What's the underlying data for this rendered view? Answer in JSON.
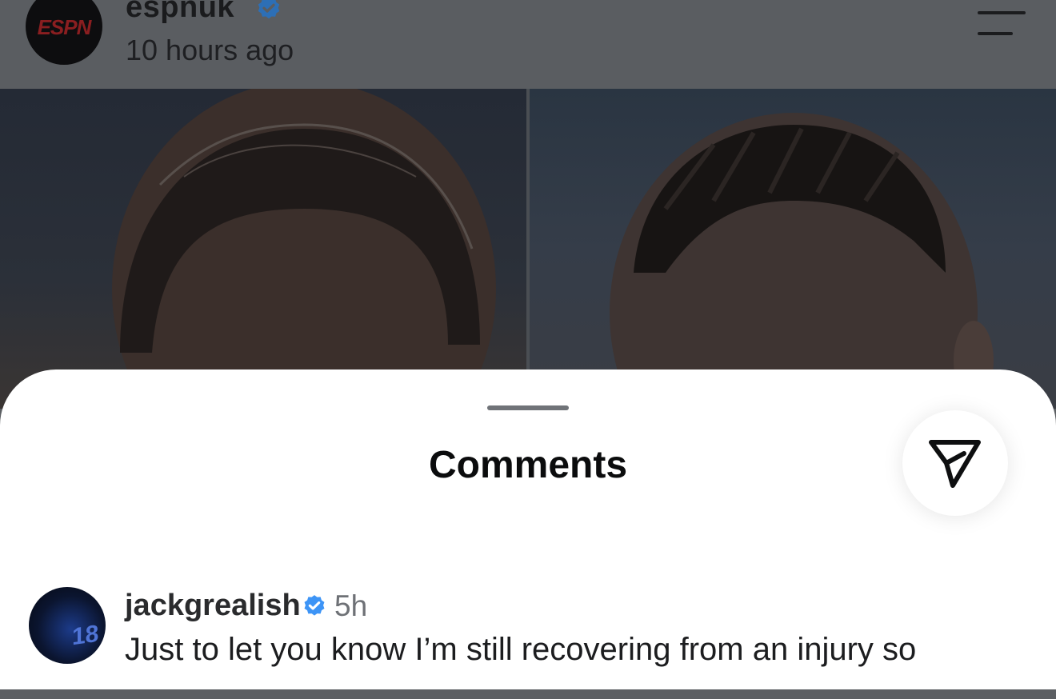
{
  "post": {
    "username": "espnuk",
    "time": "10 hours ago",
    "avatar_logo": "ESPN",
    "verified_color": "#3d94f6"
  },
  "sheet": {
    "title": "Comments"
  },
  "comment": {
    "username": "jackgrealish",
    "time": "5h",
    "avatar_number": "18",
    "text": "Just to let you know I’m still recovering from an injury so"
  },
  "icons": {
    "share": "paper-plane-icon",
    "menu": "hamburger-menu-icon",
    "verified": "verified-badge-icon"
  }
}
